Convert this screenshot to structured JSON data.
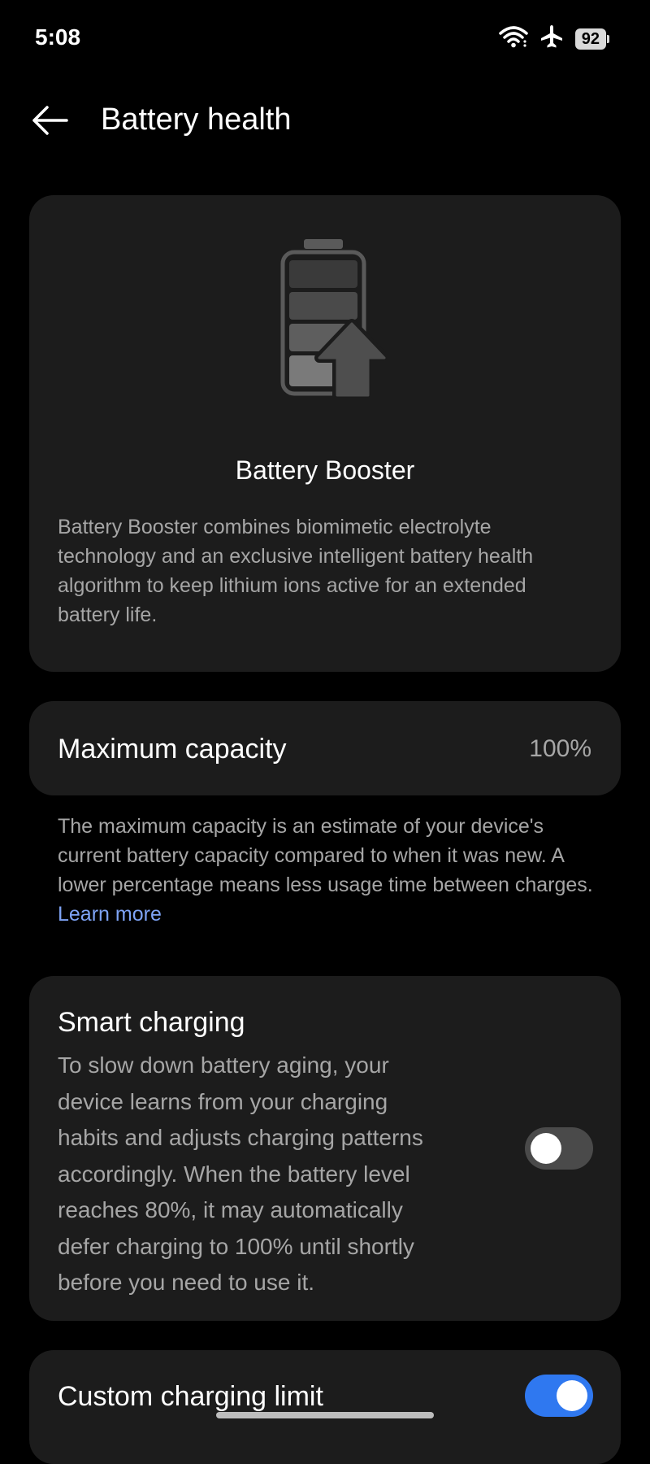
{
  "status_bar": {
    "time": "5:08",
    "battery_level": "92",
    "icons": [
      "wifi-icon",
      "airplane-mode-icon",
      "battery-icon"
    ]
  },
  "header": {
    "title": "Battery health",
    "back_icon": "back-arrow-icon"
  },
  "booster": {
    "illustration_icon": "battery-booster-icon",
    "title": "Battery Booster",
    "description": "Battery Booster combines biomimetic electrolyte technology and an exclusive intelligent battery health algorithm to keep lithium ions active for an extended battery life."
  },
  "capacity": {
    "label": "Maximum capacity",
    "value": "100%",
    "note": "The maximum capacity is an estimate of your device's current battery capacity compared to when it was new. A lower percentage means less usage time between charges.",
    "learn_more": "Learn more"
  },
  "smart_charging": {
    "title": "Smart charging",
    "description": "To slow down battery aging, your device learns from your charging habits and adjusts charging patterns accordingly. When the battery level reaches 80%, it may automatically defer charging to 100% until shortly before you need to use it.",
    "enabled": false
  },
  "custom_limit": {
    "title": "Custom charging limit",
    "enabled": true
  },
  "colors": {
    "background": "#000000",
    "card": "#1c1c1c",
    "secondary_text": "#a6a6a6",
    "link": "#7ea3f5",
    "toggle_on": "#2f78f0",
    "toggle_off": "#4a4a4a"
  }
}
